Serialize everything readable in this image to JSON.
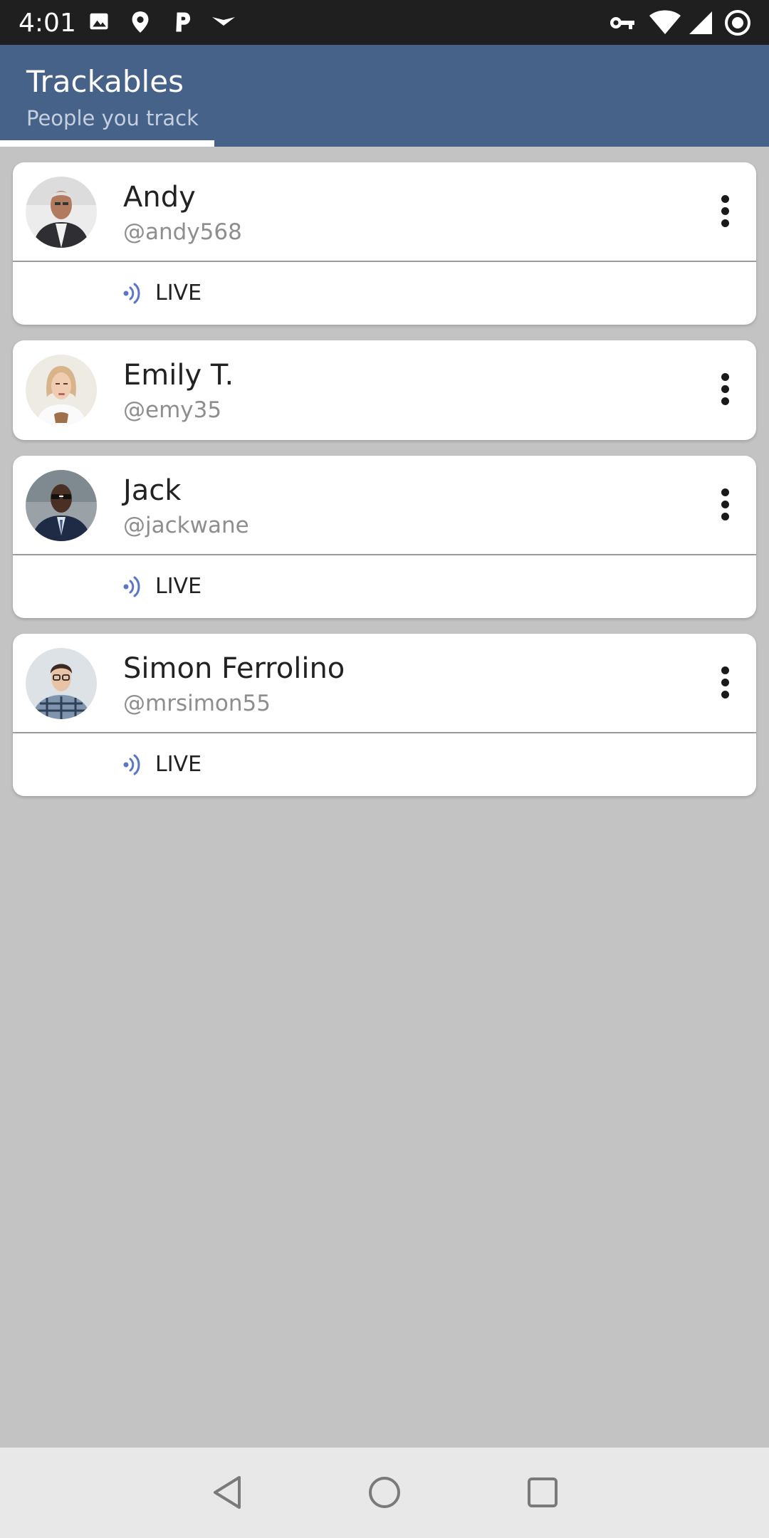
{
  "status_bar": {
    "time": "4:01",
    "left_icons": [
      "image-icon",
      "location-pin-icon",
      "parking-icon",
      "download-arrow-icon"
    ],
    "right_icons": [
      "vpn-key-icon",
      "wifi-icon",
      "cell-signal-icon",
      "sync-circle-icon"
    ]
  },
  "app_bar": {
    "title": "Trackables",
    "subtitle": "People you track",
    "color": "#476289"
  },
  "trackables": [
    {
      "name": "Andy",
      "handle": "@andy568",
      "live": true,
      "live_label": "LIVE"
    },
    {
      "name": "Emily T.",
      "handle": "@emy35",
      "live": false
    },
    {
      "name": "Jack",
      "handle": "@jackwane",
      "live": true,
      "live_label": "LIVE"
    },
    {
      "name": "Simon Ferrolino",
      "handle": "@mrsimon55",
      "live": true,
      "live_label": "LIVE"
    }
  ],
  "nav_bar": {
    "buttons": [
      "back-triangle-icon",
      "home-circle-icon",
      "recents-square-icon"
    ]
  },
  "colors": {
    "accent_live": "#5b76c9",
    "background": "#c3c3c3"
  }
}
